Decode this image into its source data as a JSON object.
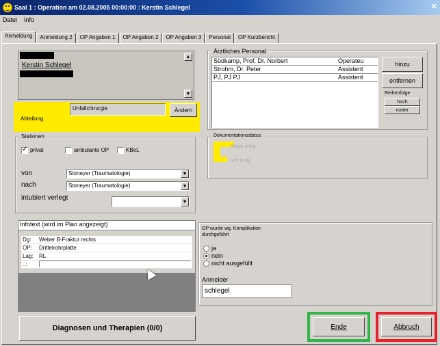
{
  "window": {
    "title": "Saal 1 : Operation am 02.08.2005 00:00:00 : Kerstin Schlegel"
  },
  "menu": [
    "Datei",
    "Info"
  ],
  "tabs": [
    "Anmeldung",
    "Anmeldung 2",
    "OP Angaben 1",
    "OP Angaben 2",
    "OP Angaben 3",
    "Personal",
    "OP Kurzbericht"
  ],
  "patient": {
    "name": "Kerstin Schlegel"
  },
  "abteilung": {
    "label": "Abteilung",
    "value": "Unfallchirurgie",
    "button": "Ändern",
    "highlight_color": "#ffeb00"
  },
  "stationen": {
    "title": "Stationen",
    "privat_label": "privat",
    "privat_checked": true,
    "ambulant_label": "ambulante OP",
    "ambulant_checked": false,
    "kbel_label": "KBeL",
    "kbel_checked": false,
    "von_label": "von",
    "von_value": "Stoneyer (Traumatologie)",
    "nach_label": "nach",
    "nach_value": "Stoneyer (Traumatologie)",
    "intubiert_label": "intubiert verlegt",
    "intubiert_value": ""
  },
  "personal": {
    "title": "Ärztliches Personal",
    "rows": [
      {
        "name": "Südkamp, Prof. Dr. Norbert",
        "role": "Operateu"
      },
      {
        "name": "Strohm, Dr. Peter",
        "role": "Assistent"
      },
      {
        "name": "PJ, PJ PJ",
        "role": "Assistent"
      }
    ],
    "hinzu": "hinzu",
    "entfernen": "entfernen",
    "reihenfolge_label": "Reihenfolge",
    "hoch": "hoch",
    "runter": "runter"
  },
  "dokumentation": {
    "title": "Dokumentationsstatus",
    "pflege": "Pflege fertig",
    "arzt": "Arzt fertig"
  },
  "infotext": {
    "title": "Infotext (wird im Plan angezeigt)",
    "lines": [
      {
        "key": "Dg:",
        "value": "Weber B-Fraktur rechts"
      },
      {
        "key": "OP:",
        "value": "Drittelrohrplatte"
      },
      {
        "key": "Lag:",
        "value": "RL"
      },
      {
        "key": "..:",
        "value": ""
      }
    ]
  },
  "op_wurde": {
    "title": "OP wurde wg. Komplikation durchgeführt",
    "options": [
      "ja",
      "nein",
      "nicht ausgefüllt"
    ],
    "selected": "nein"
  },
  "anmelder": {
    "label": "Anmelder",
    "value": "schlegel"
  },
  "buttons": {
    "diagnosen": "Diagnosen und Therapien (0/0)",
    "ende": "Ende",
    "abbruch": "Abbruch"
  },
  "colors": {
    "ende_frame": "#33b54a",
    "abbruch_frame": "#e8202a",
    "yellow": "#ffeb00"
  }
}
